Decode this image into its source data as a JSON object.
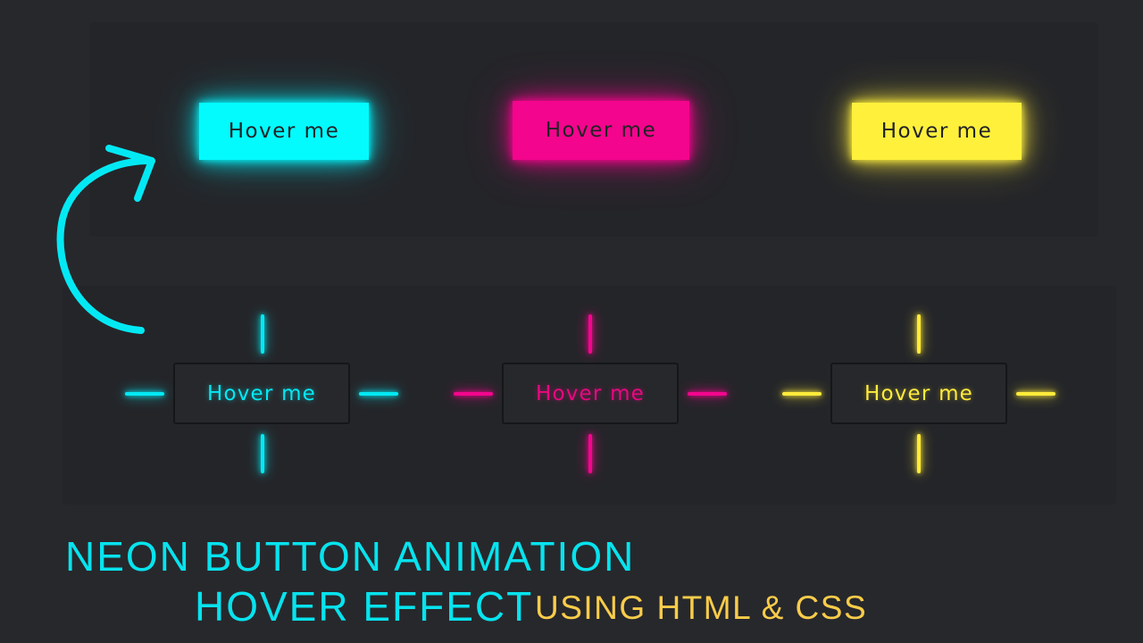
{
  "buttons": {
    "filled": [
      {
        "label": "Hover me",
        "color": "#03fbfd"
      },
      {
        "label": "Hover me",
        "color": "#f3058d"
      },
      {
        "label": "Hover me",
        "color": "#fff03c"
      }
    ],
    "outline": [
      {
        "label": "Hover me",
        "color": "#03e9f4"
      },
      {
        "label": "Hover me",
        "color": "#e8087f"
      },
      {
        "label": "Hover me",
        "color": "#ffeb3b"
      }
    ]
  },
  "caption": {
    "line1": "NEON BUTTON ANIMATION",
    "line2": "HOVER EFFECT",
    "line3": "USING HTML & CSS"
  },
  "colors": {
    "background": "#27282c",
    "cyan": "#03e9f4",
    "pink": "#f3058d",
    "yellow": "#ffeb3b",
    "caption_accent": "#f9cc4a"
  },
  "icons": {
    "arrow": "curved-arrow-icon"
  }
}
